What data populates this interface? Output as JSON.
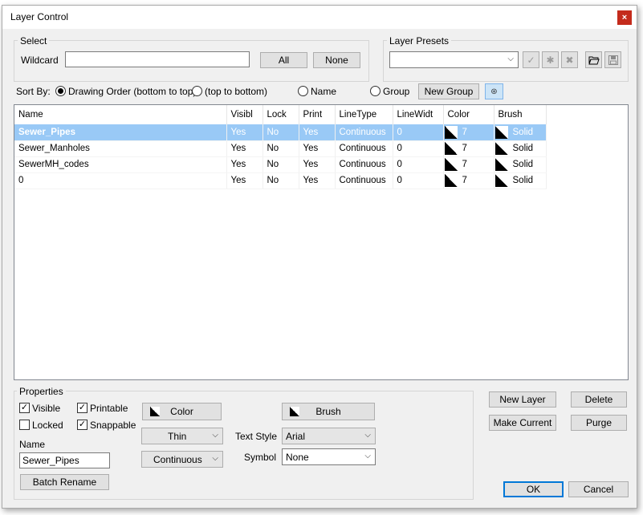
{
  "window": {
    "title": "Layer Control",
    "close_glyph": "×"
  },
  "select": {
    "group_label": "Select",
    "wildcard_label": "Wildcard",
    "wildcard_value": "",
    "all_label": "All",
    "none_label": "None"
  },
  "presets": {
    "group_label": "Layer Presets",
    "selected_value": "",
    "apply_icon": "check-icon",
    "new_icon": "asterisk-icon",
    "delete_icon": "x-icon",
    "open_icon": "folder-open-icon",
    "save_icon": "save-icon"
  },
  "sort": {
    "label": "Sort By:",
    "options": [
      "Drawing Order (bottom to top)",
      "(top to bottom)",
      "Name",
      "Group"
    ],
    "selected_index": 0,
    "new_group_label": "New Group",
    "collapse_icon": "collapse-icon"
  },
  "layers": {
    "columns": [
      "Name",
      "Visibl",
      "Lock",
      "Print",
      "LineType",
      "LineWidt",
      "Color",
      "Brush"
    ],
    "rows": [
      {
        "name": "Sewer_Pipes",
        "visible": "Yes",
        "lock": "No",
        "print": "Yes",
        "linetype": "Continuous",
        "linewidth": "0",
        "color": "7",
        "brush": "Solid",
        "selected": true
      },
      {
        "name": "Sewer_Manholes",
        "visible": "Yes",
        "lock": "No",
        "print": "Yes",
        "linetype": "Continuous",
        "linewidth": "0",
        "color": "7",
        "brush": "Solid",
        "selected": false
      },
      {
        "name": "SewerMH_codes",
        "visible": "Yes",
        "lock": "No",
        "print": "Yes",
        "linetype": "Continuous",
        "linewidth": "0",
        "color": "7",
        "brush": "Solid",
        "selected": false
      },
      {
        "name": "0",
        "visible": "Yes",
        "lock": "No",
        "print": "Yes",
        "linetype": "Continuous",
        "linewidth": "0",
        "color": "7",
        "brush": "Solid",
        "selected": false
      }
    ],
    "selection_color": "#99c9f6"
  },
  "properties": {
    "group_label": "Properties",
    "visible_label": "Visible",
    "visible_checked": true,
    "printable_label": "Printable",
    "printable_checked": true,
    "locked_label": "Locked",
    "locked_checked": false,
    "snappable_label": "Snappable",
    "snappable_checked": true,
    "name_label": "Name",
    "name_value": "Sewer_Pipes",
    "batch_rename_label": "Batch Rename",
    "color_label": "Color",
    "brush_label": "Brush",
    "linewidth_value": "Thin",
    "linetype_value": "Continuous",
    "text_style_label": "Text Style",
    "text_style_value": "Arial",
    "symbol_label": "Symbol",
    "symbol_value": "None"
  },
  "actions": {
    "new_layer": "New Layer",
    "delete": "Delete",
    "make_current": "Make Current",
    "purge": "Purge",
    "ok": "OK",
    "cancel": "Cancel"
  }
}
